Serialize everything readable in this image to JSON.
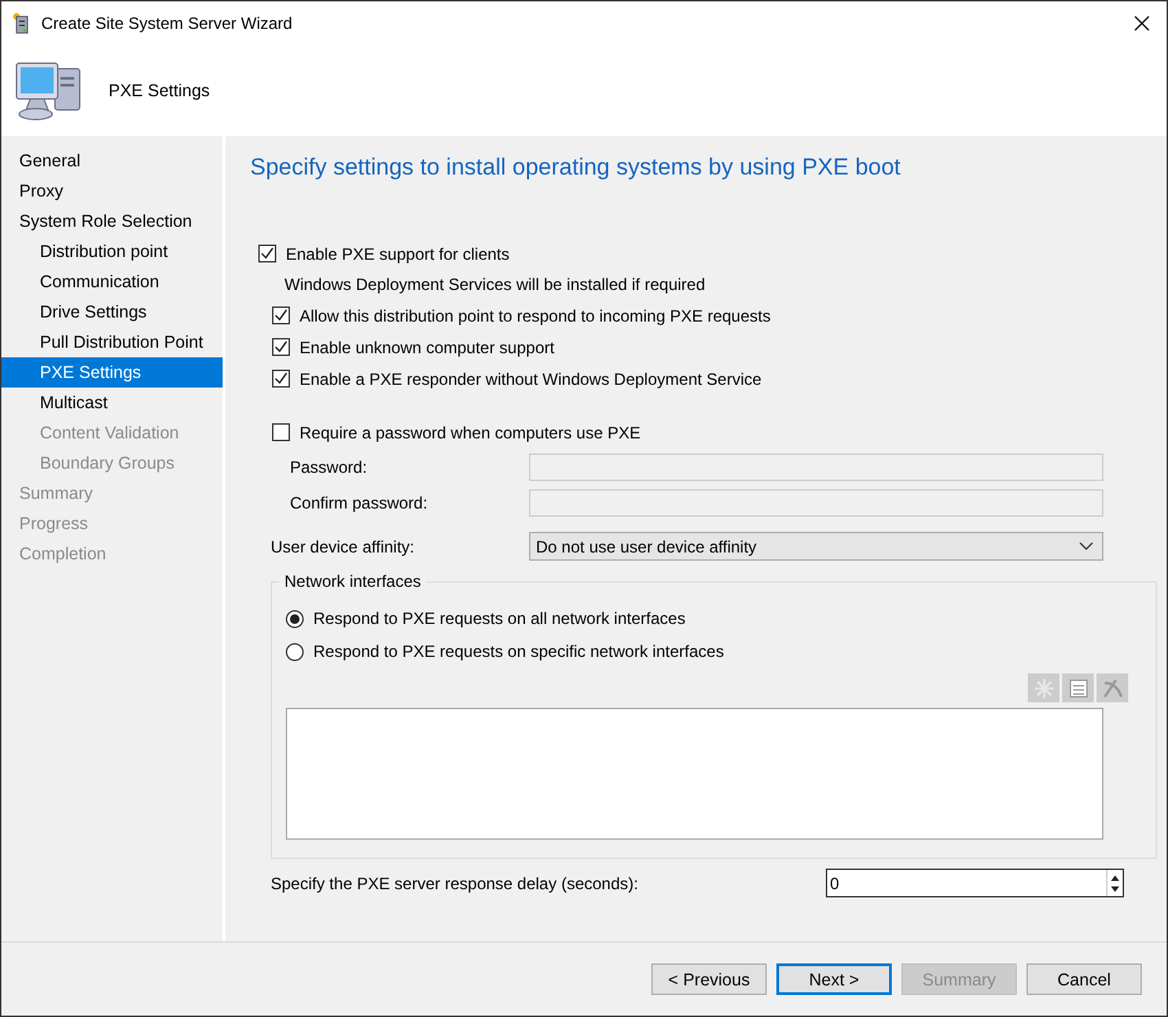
{
  "window": {
    "title": "Create Site System Server Wizard"
  },
  "header": {
    "title": "PXE Settings"
  },
  "sidebar": {
    "items": [
      {
        "label": "General",
        "selected": false,
        "disabled": false
      },
      {
        "label": "Proxy",
        "selected": false,
        "disabled": false
      },
      {
        "label": "System Role Selection",
        "selected": false,
        "disabled": false,
        "children": [
          {
            "label": "Distribution point",
            "selected": false,
            "disabled": false
          },
          {
            "label": "Communication",
            "selected": false,
            "disabled": false
          },
          {
            "label": "Drive Settings",
            "selected": false,
            "disabled": false
          },
          {
            "label": "Pull Distribution Point",
            "selected": false,
            "disabled": false
          },
          {
            "label": "PXE Settings",
            "selected": true,
            "disabled": false
          },
          {
            "label": "Multicast",
            "selected": false,
            "disabled": false
          },
          {
            "label": "Content Validation",
            "selected": false,
            "disabled": true
          },
          {
            "label": "Boundary Groups",
            "selected": false,
            "disabled": true
          }
        ]
      },
      {
        "label": "Summary",
        "selected": false,
        "disabled": true
      },
      {
        "label": "Progress",
        "selected": false,
        "disabled": true
      },
      {
        "label": "Completion",
        "selected": false,
        "disabled": true
      }
    ]
  },
  "page": {
    "heading": "Specify settings to install operating systems by using PXE boot",
    "pxe_support": {
      "label": "Enable PXE support for clients",
      "checked": true,
      "note": "Windows Deployment Services will be installed if required",
      "options": [
        {
          "label": "Allow this distribution point to respond to incoming PXE requests",
          "checked": true
        },
        {
          "label": "Enable unknown computer support",
          "checked": true
        },
        {
          "label": "Enable a PXE responder without Windows Deployment Service",
          "checked": true
        }
      ]
    },
    "password": {
      "label": "Require a password when computers use PXE",
      "checked": false,
      "fields": [
        {
          "label": "Password:",
          "disabled": true
        },
        {
          "label": "Confirm password:",
          "disabled": true
        }
      ]
    },
    "affinity": {
      "label": "User device affinity:",
      "value": "Do not use user device affinity"
    },
    "network_interfaces": {
      "title": "Network interfaces",
      "options": [
        {
          "label": "Respond to PXE requests on all network interfaces",
          "selected": true
        },
        {
          "label": "Respond to PXE requests on specific network interfaces",
          "selected": false
        }
      ]
    },
    "delay": {
      "label": "Specify the PXE server response delay (seconds):",
      "value": "0"
    }
  },
  "buttons": [
    {
      "label": "< Previous",
      "default": false,
      "disabled": false
    },
    {
      "label": "Next >",
      "default": true,
      "disabled": false
    },
    {
      "label": "Summary",
      "default": false,
      "disabled": true
    },
    {
      "label": "Cancel",
      "default": false,
      "disabled": false
    }
  ]
}
